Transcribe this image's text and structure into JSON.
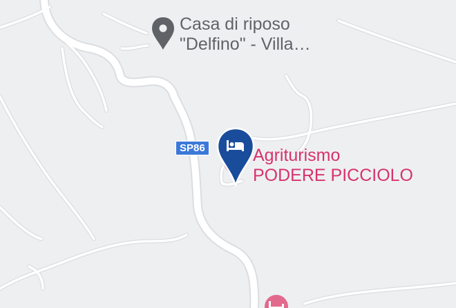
{
  "map": {
    "route_shield": {
      "label": "SP86",
      "color": "#3c78d8"
    },
    "pois": [
      {
        "line1": "Casa di riposo",
        "line2": "\"Delfino\" - Villa…",
        "icon": "place-pin-icon",
        "color": "#5f6368"
      },
      {
        "line1": "Agriturismo",
        "line2": "PODERE PICCIOLO",
        "icon": "hotel-bed-icon",
        "color": "#d6336c",
        "selected": true,
        "selected_marker_color": "#1a4c9c"
      },
      {
        "line1": "",
        "icon": "hotel-bed-icon",
        "color": "#d6336c"
      }
    ],
    "colors": {
      "background": "#eeeff1",
      "road": "#ffffff"
    }
  }
}
